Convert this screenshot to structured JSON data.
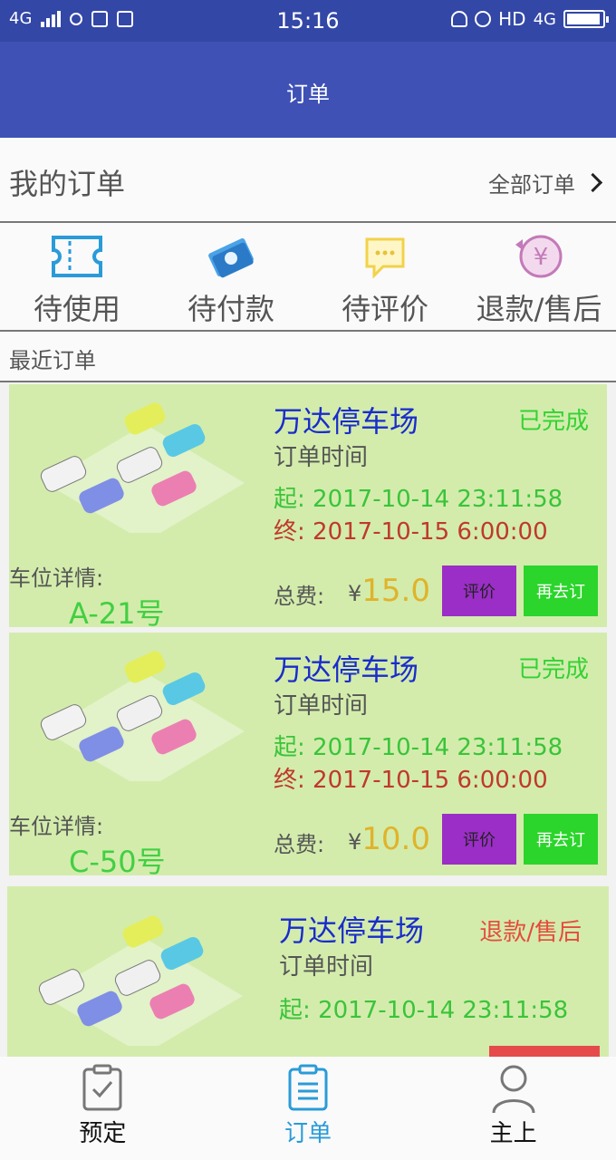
{
  "status_bar": {
    "network": "4G",
    "time": "15:16",
    "right_text": "HD",
    "right_network": "4G",
    "battery_level": 0.95
  },
  "app_bar": {
    "title": "订单"
  },
  "my_orders": {
    "title": "我的订单",
    "all_link": "全部订单"
  },
  "categories": [
    {
      "label": "待使用",
      "icon": "ticket-icon"
    },
    {
      "label": "待付款",
      "icon": "money-icon"
    },
    {
      "label": "待评价",
      "icon": "comment-icon"
    },
    {
      "label": "退款/售后",
      "icon": "refund-yen-icon"
    }
  ],
  "recent_label": "最近订单",
  "orders": [
    {
      "lot": "万达停车场",
      "status": "已完成",
      "status_color": "#34d234",
      "time_label": "订单时间",
      "start": "起: 2017-10-14 23:11:58",
      "end": "终: 2017-10-15 6:00:00",
      "detail_label": "车位详情:",
      "slot": "A-21号",
      "total_label": "总费:",
      "currency": "¥",
      "total": "15.0",
      "rate_label": "评价",
      "rebook_label": "再去订"
    },
    {
      "lot": "万达停车场",
      "status": "已完成",
      "status_color": "#34d234",
      "time_label": "订单时间",
      "start": "起: 2017-10-14 23:11:58",
      "end": "终: 2017-10-15 6:00:00",
      "detail_label": "车位详情:",
      "slot": "C-50号",
      "total_label": "总费:",
      "currency": "¥",
      "total": "10.0",
      "rate_label": "评价",
      "rebook_label": "再去订"
    },
    {
      "lot": "万达停车场",
      "status": "退款/售后",
      "status_color": "#e64b3c",
      "time_label": "订单时间",
      "start": "起: 2017-10-14 23:11:58"
    }
  ],
  "tabs": [
    {
      "label": "预定",
      "icon": "clipboard-check-icon"
    },
    {
      "label": "订单",
      "icon": "clipboard-list-icon",
      "active": true
    },
    {
      "label": "主上",
      "icon": "user-icon"
    }
  ],
  "colors": {
    "primary": "#3f51b5",
    "card_bg": "#d3ecac",
    "active_tab": "#2a9bd8"
  }
}
